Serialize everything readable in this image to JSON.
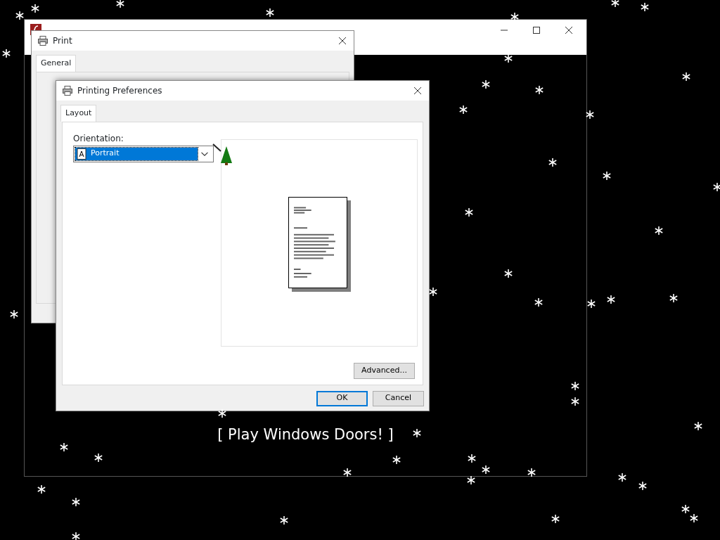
{
  "flash_window": {
    "caption": "[ Play Windows Doors! ]"
  },
  "print_dialog": {
    "title": "Print",
    "tabs": [
      {
        "label": "General",
        "selected": true
      }
    ]
  },
  "preferences_dialog": {
    "title": "Printing Preferences",
    "tabs": [
      {
        "label": "Layout",
        "selected": true
      }
    ],
    "orientation": {
      "label": "Orientation:",
      "value": "Portrait",
      "focused": true
    },
    "advanced_button": "Advanced...",
    "buttons": [
      {
        "label": "OK",
        "default": true
      },
      {
        "label": "Cancel",
        "default": false
      }
    ]
  }
}
